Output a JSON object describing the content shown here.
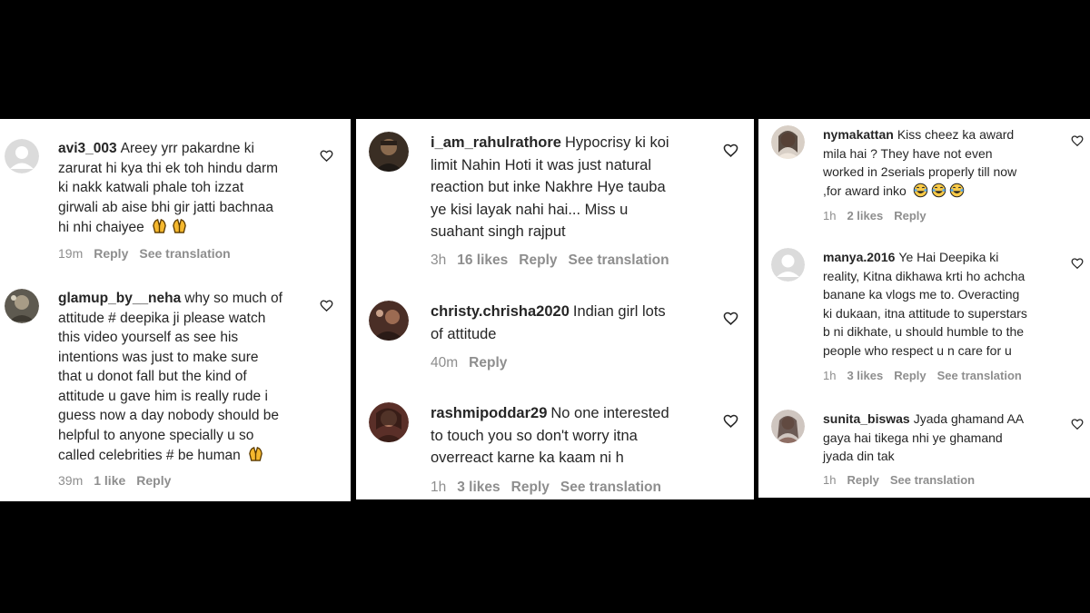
{
  "panel1": {
    "c1": {
      "username": "avi3_003",
      "lines": [
        "Areey yrr pakardne ki",
        "zarurat hi kya thi ek toh hindu darm",
        "ki nakk katwali phale toh izzat",
        "girwali ab aise bhi gir jatti bachnaa",
        "hi nhi chaiyee"
      ],
      "emojis": [
        "praying-hands",
        "praying-hands"
      ],
      "time": "19m",
      "reply": "Reply",
      "translate": "See translation"
    },
    "c2": {
      "username": "glamup_by__neha",
      "lines": [
        "why so much of",
        "attitude # deepika ji please watch",
        "this video yourself as see his",
        "intentions was just to make sure",
        "that u donot fall but the kind of",
        "attitude u gave him is really rude i",
        "guess now a day nobody should be",
        "helpful to anyone specially u so",
        "called celebrities # be human"
      ],
      "emojis": [
        "praying-hands"
      ],
      "time": "39m",
      "likes": "1 like",
      "reply": "Reply"
    }
  },
  "panel2": {
    "c1": {
      "username": "i_am_rahulrathore",
      "lines": [
        "Hypocrisy ki koi",
        "limit Nahin Hoti it was just natural",
        "reaction but inke Nakhre Hye tauba",
        "ye kisi layak nahi hai... Miss u",
        "suahant singh rajput"
      ],
      "time": "3h",
      "likes": "16 likes",
      "reply": "Reply",
      "translate": "See translation"
    },
    "c2": {
      "username": "christy.chrisha2020",
      "lines": [
        "Indian girl lots",
        "of attitude"
      ],
      "time": "40m",
      "reply": "Reply"
    },
    "c3": {
      "username": "rashmipoddar29",
      "lines": [
        "No one interested",
        "to touch you so don't worry itna",
        "overreact karne ka kaam ni h"
      ],
      "time": "1h",
      "likes": "3 likes",
      "reply": "Reply",
      "translate": "See translation"
    }
  },
  "panel3": {
    "c1": {
      "username": "nymakattan",
      "lines": [
        "Kiss cheez ka award",
        "mila hai ? They have not even",
        "worked in 2serials properly till now",
        ",for award inko"
      ],
      "emojis": [
        "tears-of-joy",
        "tears-of-joy",
        "tears-of-joy"
      ],
      "time": "1h",
      "likes": "2 likes",
      "reply": "Reply"
    },
    "c2": {
      "username": "manya.2016",
      "lines": [
        "Ye Hai Deepika ki",
        "reality, Kitna dikhawa krti ho achcha",
        "banane ka vlogs me to. Overacting",
        "ki dukaan, itna attitude to superstars",
        "b ni dikhate, u should humble to the",
        "people who respect u n care for u"
      ],
      "time": "1h",
      "likes": "3 likes",
      "reply": "Reply",
      "translate": "See translation"
    },
    "c3": {
      "username": "sunita_biswas",
      "lines": [
        "Jyada ghamand AA",
        "gaya hai tikega nhi ye ghamand",
        "jyada din tak"
      ],
      "time": "1h",
      "reply": "Reply",
      "translate": "See translation"
    }
  },
  "colors": {
    "meta": "#8e8e8e",
    "text": "#262626",
    "background": "#000000",
    "panel": "#ffffff"
  }
}
